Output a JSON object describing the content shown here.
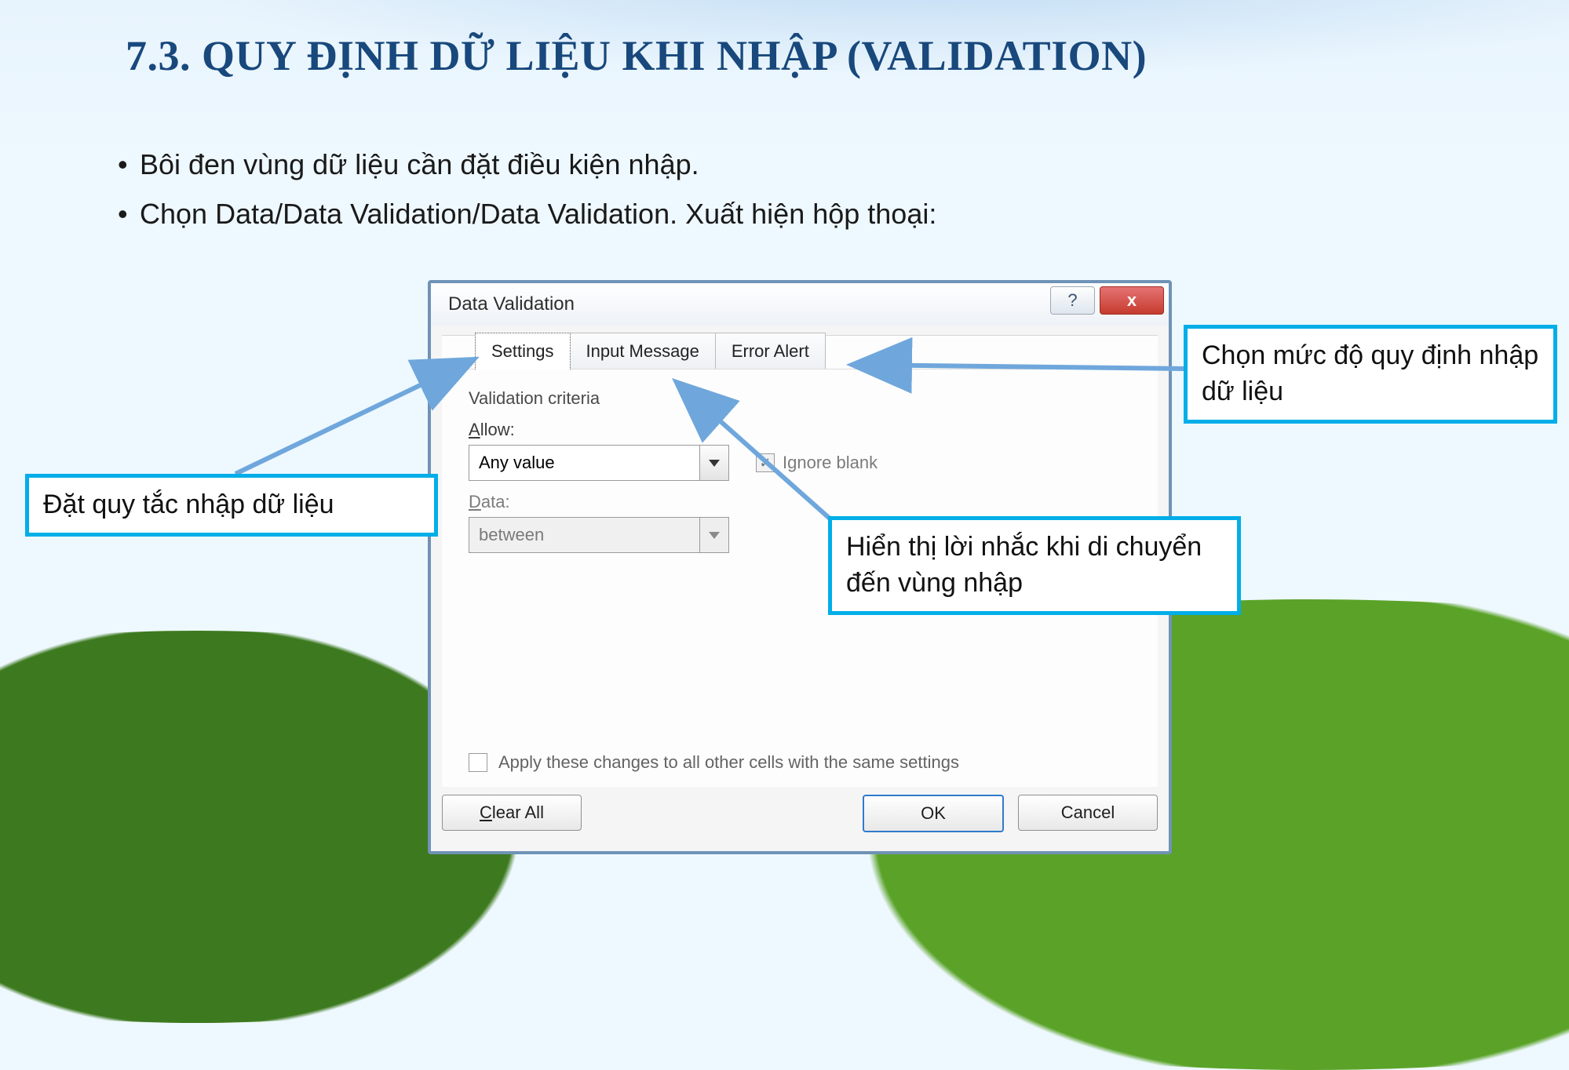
{
  "slide": {
    "title": "7.3. QUY ĐỊNH DỮ LIỆU KHI NHẬP (VALIDATION)",
    "bullet1": "Bôi đen vùng dữ liệu cần đặt điều kiện nhập.",
    "bullet2": "Chọn Data/Data Validation/Data Validation. Xuất hiện hộp thoại:"
  },
  "dialog": {
    "title": "Data Validation",
    "help_symbol": "?",
    "close_symbol": "x",
    "tabs": {
      "settings": "Settings",
      "input_message": "Input Message",
      "error_alert": "Error Alert"
    },
    "group": "Validation criteria",
    "allow_pre": "A",
    "allow_post": "llow:",
    "allow_value": "Any value",
    "data_pre": "D",
    "data_post": "ata:",
    "data_value": "between",
    "ignore_pre": "I",
    "ignore_post": "gnore blank",
    "apply_pre": "Apply these changes to all other cells with the same settings",
    "clear_pre": "C",
    "clear_post": "lear All",
    "ok": "OK",
    "cancel": "Cancel"
  },
  "callouts": {
    "c1": "Đặt quy tắc nhập dữ liệu",
    "c2": "Hiển thị lời nhắc khi di chuyển đến vùng nhập",
    "c3": "Chọn mức độ quy định nhập dữ liệu"
  }
}
